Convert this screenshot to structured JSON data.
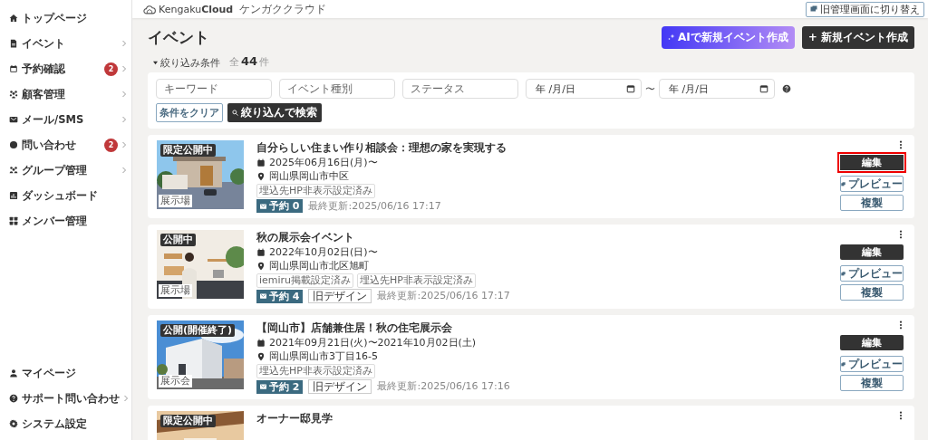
{
  "sidebar": {
    "items": [
      {
        "label": "トップページ",
        "expandable": false
      },
      {
        "label": "イベント",
        "expandable": true
      },
      {
        "label": "予約確認",
        "badge": "2",
        "expandable": true
      },
      {
        "label": "顧客管理",
        "expandable": true
      },
      {
        "label": "メール/SMS",
        "expandable": true
      },
      {
        "label": "問い合わせ",
        "badge": "2",
        "expandable": true
      },
      {
        "label": "グループ管理",
        "expandable": true
      },
      {
        "label": "ダッシュボード",
        "expandable": false
      },
      {
        "label": "メンバー管理",
        "expandable": false
      }
    ],
    "bottom_items": [
      {
        "label": "マイページ",
        "expandable": false
      },
      {
        "label": "サポート問い合わせ",
        "expandable": true
      },
      {
        "label": "システム設定",
        "expandable": false
      }
    ]
  },
  "header": {
    "logo": "Kengaku**Cloud**",
    "tagline": "ケンガククラウド",
    "switch_button": "旧管理画面に切り替え"
  },
  "page": {
    "title": "イベント",
    "ai_button": "AIで新規イベント作成",
    "new_button": "+ 新規イベント作成"
  },
  "filter": {
    "toggle": "絞り込み条件",
    "expanded": true,
    "count_prefix": "全",
    "count": "44",
    "count_suffix": "件",
    "text_fields": [
      {
        "placeholder": "キーワード"
      },
      {
        "placeholder": "イベント種別"
      },
      {
        "placeholder": "ステータス"
      }
    ],
    "date_from": {
      "placeholder": "年 /月/日"
    },
    "range_separator": "〜",
    "date_to": {
      "placeholder": "年 /月/日"
    },
    "clear_button": "条件をクリア",
    "search_button": "絞り込んで検索"
  },
  "events": [
    {
      "status": "限定公開中",
      "venue": "展示場",
      "title": "自分らしい住まい作り相談会：理想の家を実現する",
      "date": "2025年06月16日(月)〜",
      "location": "岡山県岡山市中区",
      "tags": [
        "埋込先HP非表示設定済み"
      ],
      "reservations": "予約 0",
      "updated": "最終更新:2025/06/16 17:17",
      "edit": "編集",
      "edit_highlighted": true,
      "preview": "プレビュー",
      "duplicate": "複製"
    },
    {
      "status": "公開中",
      "venue": "展示場",
      "title": "秋の展示会イベント",
      "date": "2022年10月02日(日)〜",
      "location": "岡山県岡山市北区旭町",
      "tags": [
        "iemiru掲載設定済み",
        "埋込先HP非表示設定済み"
      ],
      "reservations": "予約 4",
      "design": "旧デザイン",
      "updated": "最終更新:2025/06/16 17:17",
      "edit": "編集",
      "edit_highlighted": false,
      "preview": "プレビュー",
      "duplicate": "複製"
    },
    {
      "status": "公開(開催終了)",
      "venue": "展示会",
      "title": "【岡山市】店舗兼住居！秋の住宅展示会",
      "date": "2021年09月21日(火)〜2021年10月02日(土)",
      "location": "岡山県岡山市3丁目16-5",
      "tags": [
        "埋込先HP非表示設定済み"
      ],
      "reservations": "予約 2",
      "design": "旧デザイン",
      "updated": "最終更新:2025/06/16 17:16",
      "edit": "編集",
      "edit_highlighted": false,
      "preview": "プレビュー",
      "duplicate": "複製"
    },
    {
      "status": "限定公開中",
      "title": "オーナー邸見学"
    }
  ]
}
